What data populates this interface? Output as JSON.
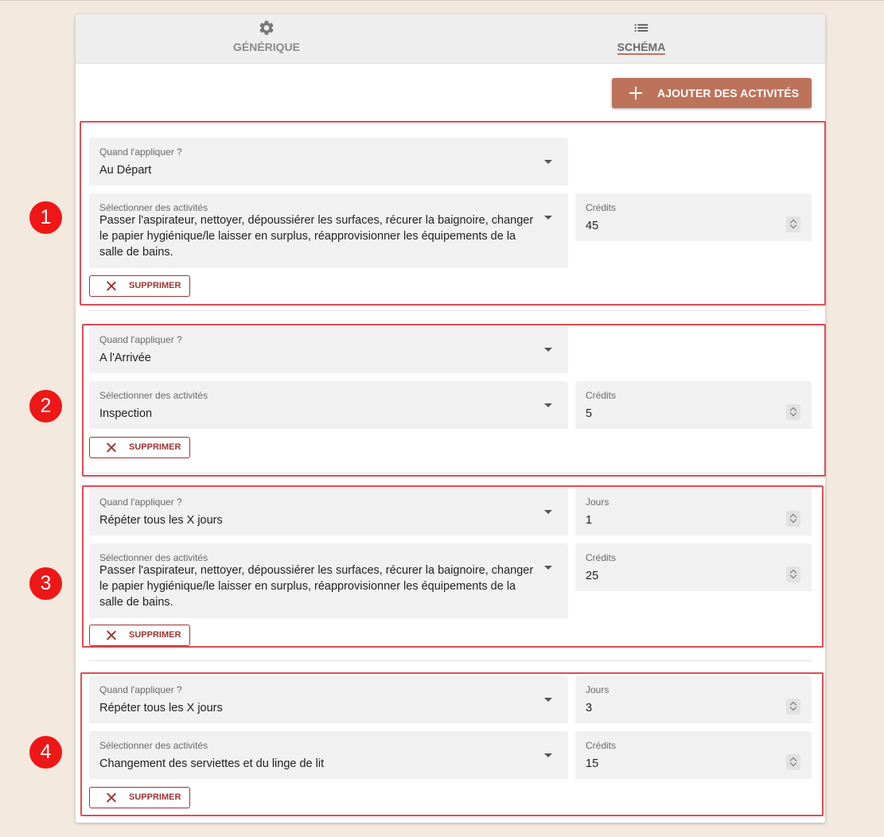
{
  "tabs": [
    {
      "label": "GÉNÉRIQUE",
      "icon": "gear-icon"
    },
    {
      "label": "SCHÉMA",
      "icon": "list-icon",
      "active": true
    }
  ],
  "add_button": {
    "label": "AJOUTER DES ACTIVITÉS",
    "icon": "plus-icon"
  },
  "labels": {
    "when": "Quand l'appliquer ?",
    "activities": "Sélectionner des activités",
    "credits": "Crédits",
    "days": "Jours",
    "delete": "SUPPRIMER"
  },
  "rules": [
    {
      "badge": "1",
      "when": "Au Départ",
      "activities": "Passer l'aspirateur, nettoyer, dépoussiérer les surfaces, récurer la baignoire, changer le papier hygiénique/le laisser en surplus, réapprovisionner les équipements de la salle de bains.",
      "credits": "45"
    },
    {
      "badge": "2",
      "when": "A l'Arrivée",
      "activities": "Inspection",
      "credits": "5"
    },
    {
      "badge": "3",
      "when": "Répéter tous les X jours",
      "days": "1",
      "activities": "Passer l'aspirateur, nettoyer, dépoussiérer les surfaces, récurer la baignoire, changer le papier hygiénique/le laisser en surplus, réapprovisionner les équipements de la salle de bains.",
      "credits": "25"
    },
    {
      "badge": "4",
      "when": "Répéter tous les X jours",
      "days": "3",
      "activities": "Changement des serviettes et du linge de lit",
      "credits": "15"
    }
  ],
  "colors": {
    "background": "#f3e9de",
    "accent": "#bd735a",
    "delete": "#9c3434",
    "highlight": "#e24b52",
    "badge": "#ef1616"
  }
}
